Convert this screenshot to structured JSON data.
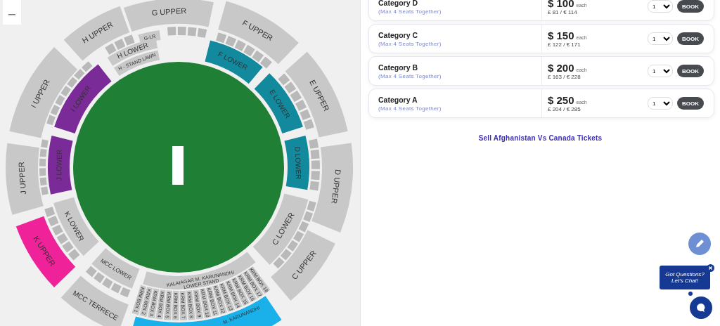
{
  "map": {
    "sections": [
      {
        "label": "G UPPER",
        "color": "#c8c8c8"
      },
      {
        "label": "F UPPER",
        "color": "#c8c8c8"
      },
      {
        "label": "E UPPER",
        "color": "#c8c8c8"
      },
      {
        "label": "D UPPER",
        "color": "#c8c8c8"
      },
      {
        "label": "C UPPER",
        "color": "#c8c8c8"
      },
      {
        "label": "M. KARUNANDHI",
        "color": "#1ab0ea"
      },
      {
        "label": "MCC TERRECE",
        "color": "#c8c8c8"
      },
      {
        "label": "K UPPER",
        "color": "#f0229a"
      },
      {
        "label": "J UPPER",
        "color": "#c8c8c8"
      },
      {
        "label": "I UPPER",
        "color": "#c8c8c8"
      },
      {
        "label": "H UPPER",
        "color": "#c8c8c8"
      },
      {
        "label": "F LOWER",
        "color": "#13899e"
      },
      {
        "label": "E LOWER",
        "color": "#13899e"
      },
      {
        "label": "D LOWER",
        "color": "#13899e"
      },
      {
        "label": "C LOWER",
        "color": "#c8c8c8"
      },
      {
        "label": "KALAIAGAR M. KARUNANDHI",
        "label_2": "LOWER STAND",
        "color": "#c8c8c8"
      },
      {
        "label": "MCC LOWER",
        "color": "#c8c8c8"
      },
      {
        "label": "K LOWER",
        "color": "#c8c8c8"
      },
      {
        "label": "J LOWER",
        "color": "#7a2b98"
      },
      {
        "label": "I LOWER",
        "color": "#7a2b98"
      },
      {
        "label": "H - STAND LAWN",
        "color": "#c8c8c8"
      },
      {
        "label": "H LOWER",
        "color": "#c8c8c8"
      },
      {
        "label": "G-LR",
        "color": "#c8c8c8"
      }
    ],
    "krm_boxes": [
      "KRM BOX 1",
      "KRM BOX 2",
      "KRM BOX 3",
      "KRM BOX 4",
      "KRM BOX 5",
      "KRM BOX 6",
      "KRM BOX 7",
      "KRM BOX 8",
      "KRM BOX 9",
      "KRM BOX 10",
      "KRM BOX 11",
      "KRM BOX 12",
      "KRM BOX 13",
      "KRM BOX 14",
      "KRM BOX 15",
      "KRM BOX 16",
      "KRM BOX 17",
      "KRM BOX 18"
    ]
  },
  "categories": [
    {
      "name": "Category D",
      "note": "(Max 4 Seats Together)",
      "price": "$ 100",
      "unit": "each",
      "alt_price": "£ 81  /  € 114",
      "quantity": "1",
      "button": "BOOK"
    },
    {
      "name": "Category C",
      "note": "(Max 4 Seats Together)",
      "price": "$ 150",
      "unit": "each",
      "alt_price": "£ 122  /  € 171",
      "quantity": "1",
      "button": "BOOK"
    },
    {
      "name": "Category B",
      "note": "(Max 4 Seats Together)",
      "price": "$ 200",
      "unit": "each",
      "alt_price": "£ 163  /  € 228",
      "quantity": "1",
      "button": "BOOK"
    },
    {
      "name": "Category A",
      "note": "(Max 4 Seats Together)",
      "price": "$ 250",
      "unit": "each",
      "alt_price": "£ 204  /  € 285",
      "quantity": "1",
      "button": "BOOK"
    }
  ],
  "sell_link": "Sell Afghanistan Vs Canada Tickets",
  "chat": {
    "bubble_line_1": "Got Questions?",
    "bubble_line_2": "Let's Chat!"
  }
}
